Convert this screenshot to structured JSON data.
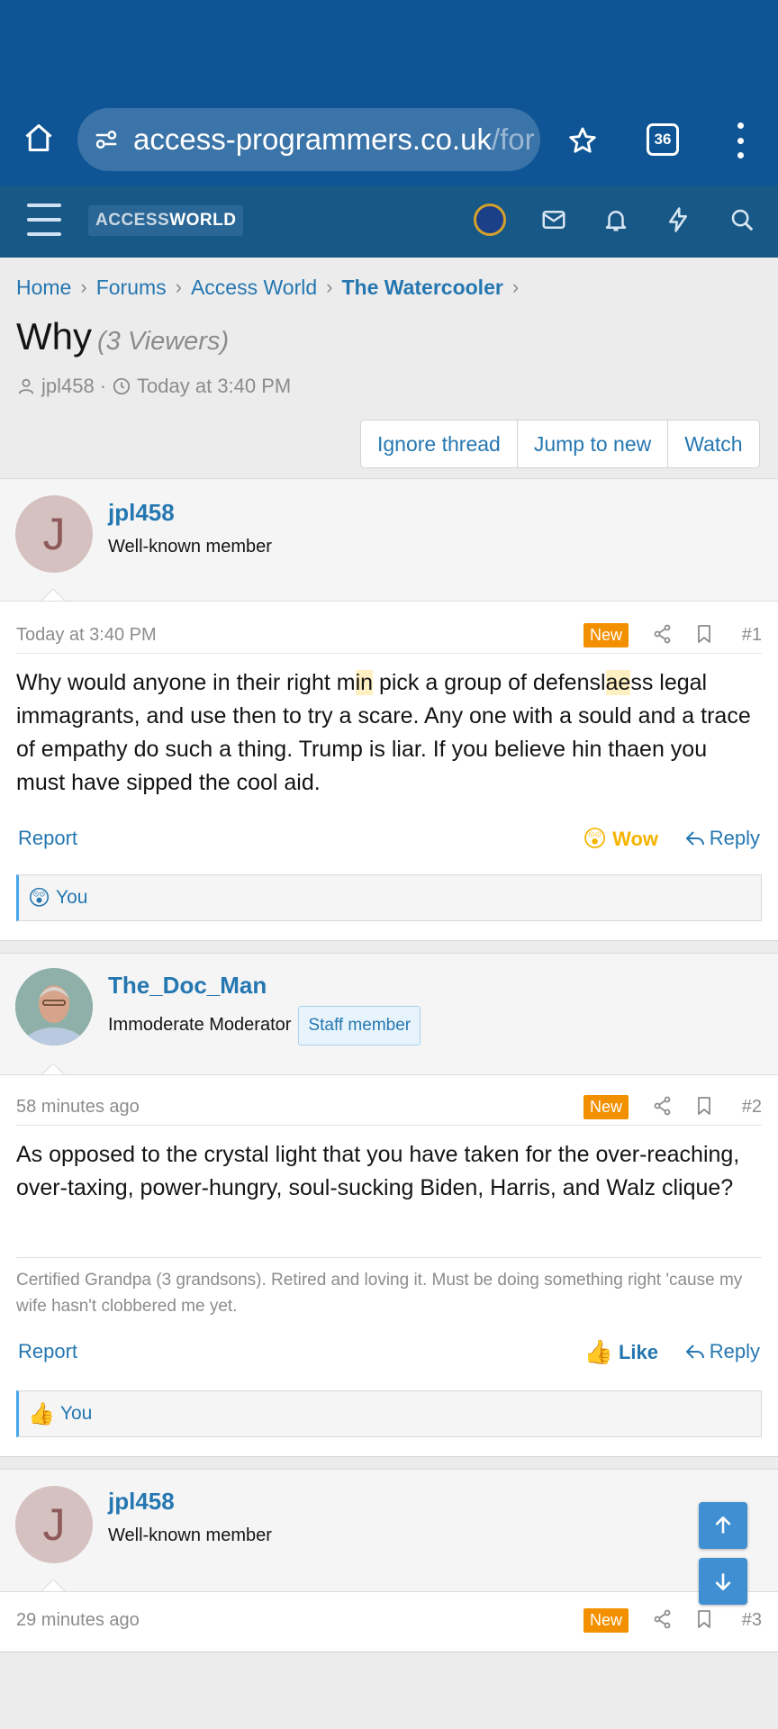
{
  "browser": {
    "url_host": "access-programmers.co.uk",
    "url_path": "/for",
    "tab_count": "36"
  },
  "site": {
    "logo_part1": "ACCESS",
    "logo_part2": "WORLD"
  },
  "breadcrumb": [
    "Home",
    "Forums",
    "Access World",
    "The Watercooler"
  ],
  "thread": {
    "title": "Why",
    "viewers": "(3 Viewers)",
    "author": "jpl458",
    "started": "Today at 3:40 PM",
    "buttons": [
      "Ignore thread",
      "Jump to new",
      "Watch"
    ]
  },
  "posts": [
    {
      "avatar_letter": "J",
      "username": "jpl458",
      "user_title": "Well-known member",
      "time": "Today at 3:40 PM",
      "new_label": "New",
      "number": "#1",
      "text_parts": [
        "Why would anyone in their right m",
        "in",
        " pick a group of defensl",
        "ae",
        "ss legal immagrants, and use then to try a scare. Any one with a sould and a trace of empathy do such a thing. Trump is liar. If you believe hin thaen you must have sipped the cool aid."
      ],
      "report": "Report",
      "reaction_label": "Wow",
      "reaction_emoji": "😲",
      "reply": "Reply",
      "reacted_by": "You"
    },
    {
      "username": "The_Doc_Man",
      "user_title": "Immoderate Moderator",
      "staff_badge": "Staff member",
      "time": "58 minutes ago",
      "new_label": "New",
      "number": "#2",
      "text": "As opposed to the crystal light that you have taken for the over-reaching, over-taxing, power-hungry, soul-sucking Biden, Harris, and Walz clique?",
      "signature": "Certified Grandpa (3 grandsons). Retired and loving it. Must be doing something right 'cause my wife hasn't clobbered me yet.",
      "report": "Report",
      "reaction_label": "Like",
      "reaction_emoji": "👍",
      "reply": "Reply",
      "reacted_by": "You"
    },
    {
      "avatar_letter": "J",
      "username": "jpl458",
      "user_title": "Well-known member",
      "time": "29 minutes ago",
      "new_label": "New",
      "number": "#3"
    }
  ],
  "colors": {
    "chrome": "#0f5595",
    "nav": "#185886",
    "link": "#2577b1",
    "new_badge": "#f39000",
    "wow": "#f5b400"
  },
  "icons": [
    "home-icon",
    "site-settings-icon",
    "star-icon",
    "tab-switcher-icon",
    "more-vert-icon",
    "hamburger-icon",
    "trophy-badge-icon",
    "mail-icon",
    "bell-icon",
    "bolt-icon",
    "search-icon",
    "user-icon",
    "clock-icon",
    "share-icon",
    "bookmark-icon",
    "reply-icon",
    "arrow-up-icon",
    "arrow-down-icon"
  ]
}
